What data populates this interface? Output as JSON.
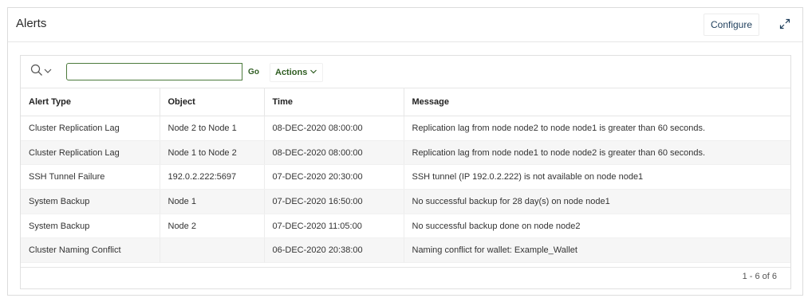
{
  "region": {
    "title": "Alerts",
    "configure_label": "Configure",
    "expand_icon": "expand-icon"
  },
  "toolbar": {
    "search_icon": "search-icon",
    "search_value": "",
    "go_label": "Go",
    "actions_label": "Actions"
  },
  "table": {
    "columns": [
      "Alert Type",
      "Object",
      "Time",
      "Message"
    ],
    "rows": [
      [
        "Cluster Replication Lag",
        "Node 2 to Node 1",
        "08-DEC-2020 08:00:00",
        "Replication lag from node node2 to node node1 is greater than 60 seconds."
      ],
      [
        "Cluster Replication Lag",
        "Node 1 to Node 2",
        "08-DEC-2020 08:00:00",
        "Replication lag from node node1 to node node2 is greater than 60 seconds."
      ],
      [
        "SSH Tunnel Failure",
        "192.0.2.222:5697",
        "07-DEC-2020 20:30:00",
        "SSH tunnel (IP 192.0.2.222) is not available on node node1"
      ],
      [
        "System Backup",
        "Node 1",
        "07-DEC-2020 16:50:00",
        "No successful backup for 28 day(s) on node node1"
      ],
      [
        "System Backup",
        "Node 2",
        "07-DEC-2020 11:05:00",
        "No successful backup done on node node2"
      ],
      [
        "Cluster Naming Conflict",
        "",
        "06-DEC-2020 20:38:00",
        "Naming conflict for wallet: Example_Wallet"
      ]
    ]
  },
  "pagination": {
    "label": "1 - 6 of 6"
  },
  "colors": {
    "accent_green": "#2f5d22",
    "input_border": "#4c7a3c",
    "link_blue": "#1f3f5c"
  }
}
